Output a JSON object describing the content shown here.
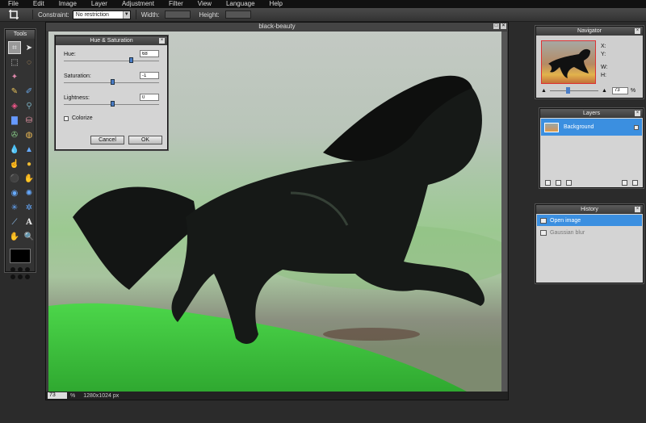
{
  "menu": [
    "File",
    "Edit",
    "Image",
    "Layer",
    "Adjustment",
    "Filter",
    "View",
    "Language",
    "Help"
  ],
  "options": {
    "constraint_label": "Constraint:",
    "constraint_value": "No restriction",
    "width_label": "Width:",
    "height_label": "Height:"
  },
  "tools_panel": {
    "title": "Tools"
  },
  "document": {
    "title": "black-beauty",
    "zoom": "73",
    "zoom_unit": "%",
    "size": "1280x1024 px"
  },
  "hue_saturation": {
    "title": "Hue & Saturation",
    "hue_label": "Hue:",
    "hue_value": "68",
    "saturation_label": "Saturation:",
    "saturation_value": "-1",
    "lightness_label": "Lightness:",
    "lightness_value": "0",
    "colorize_label": "Colorize",
    "cancel_label": "Cancel",
    "ok_label": "OK"
  },
  "navigator": {
    "title": "Navigator",
    "x_label": "X:",
    "y_label": "Y:",
    "w_label": "W:",
    "h_label": "H:",
    "zoom_value": "73",
    "zoom_unit": "%"
  },
  "layers": {
    "title": "Layers",
    "items": [
      {
        "name": "Background"
      }
    ]
  },
  "history": {
    "title": "History",
    "items": [
      {
        "label": "Open image"
      },
      {
        "label": "Gaussian blur"
      }
    ]
  }
}
